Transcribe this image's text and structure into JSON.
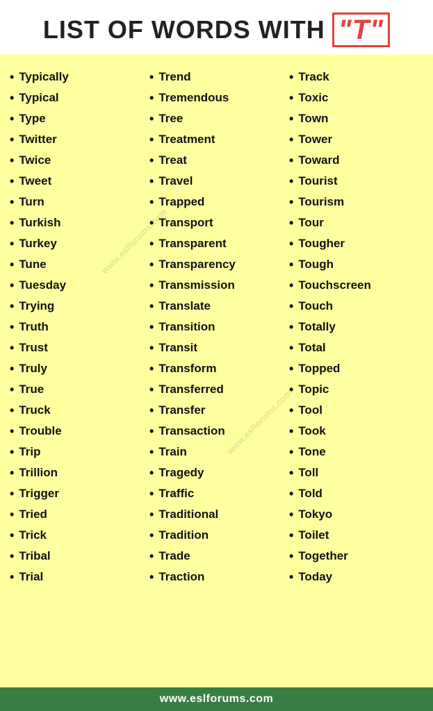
{
  "header": {
    "prefix": "LIST OF WORDS WITH",
    "highlight": "\"T\""
  },
  "columns": [
    {
      "words": [
        "Typically",
        "Typical",
        "Type",
        "Twitter",
        "Twice",
        "Tweet",
        "Turn",
        "Turkish",
        "Turkey",
        "Tune",
        "Tuesday",
        "Trying",
        "Truth",
        "Trust",
        "Truly",
        "True",
        "Truck",
        "Trouble",
        "Trip",
        "Trillion",
        "Trigger",
        "Tried",
        "Trick",
        "Tribal",
        "Trial"
      ]
    },
    {
      "words": [
        "Trend",
        "Tremendous",
        "Tree",
        "Treatment",
        "Treat",
        "Travel",
        "Trapped",
        "Transport",
        "Transparent",
        "Transparency",
        "Transmission",
        "Translate",
        "Transition",
        "Transit",
        "Transform",
        "Transferred",
        "Transfer",
        "Transaction",
        "Train",
        "Tragedy",
        "Traffic",
        "Traditional",
        "Tradition",
        "Trade",
        "Traction"
      ]
    },
    {
      "words": [
        "Track",
        "Toxic",
        "Town",
        "Tower",
        "Toward",
        "Tourist",
        "Tourism",
        "Tour",
        "Tougher",
        "Tough",
        "Touchscreen",
        "Touch",
        "Totally",
        "Total",
        "Topped",
        "Topic",
        "Tool",
        "Took",
        "Tone",
        "Toll",
        "Told",
        "Tokyo",
        "Toilet",
        "Together",
        "Today"
      ]
    }
  ],
  "watermarks": [
    "www.eslforums.com",
    "www.eslforums.com"
  ],
  "footer": {
    "text": "www.eslforums.com"
  }
}
